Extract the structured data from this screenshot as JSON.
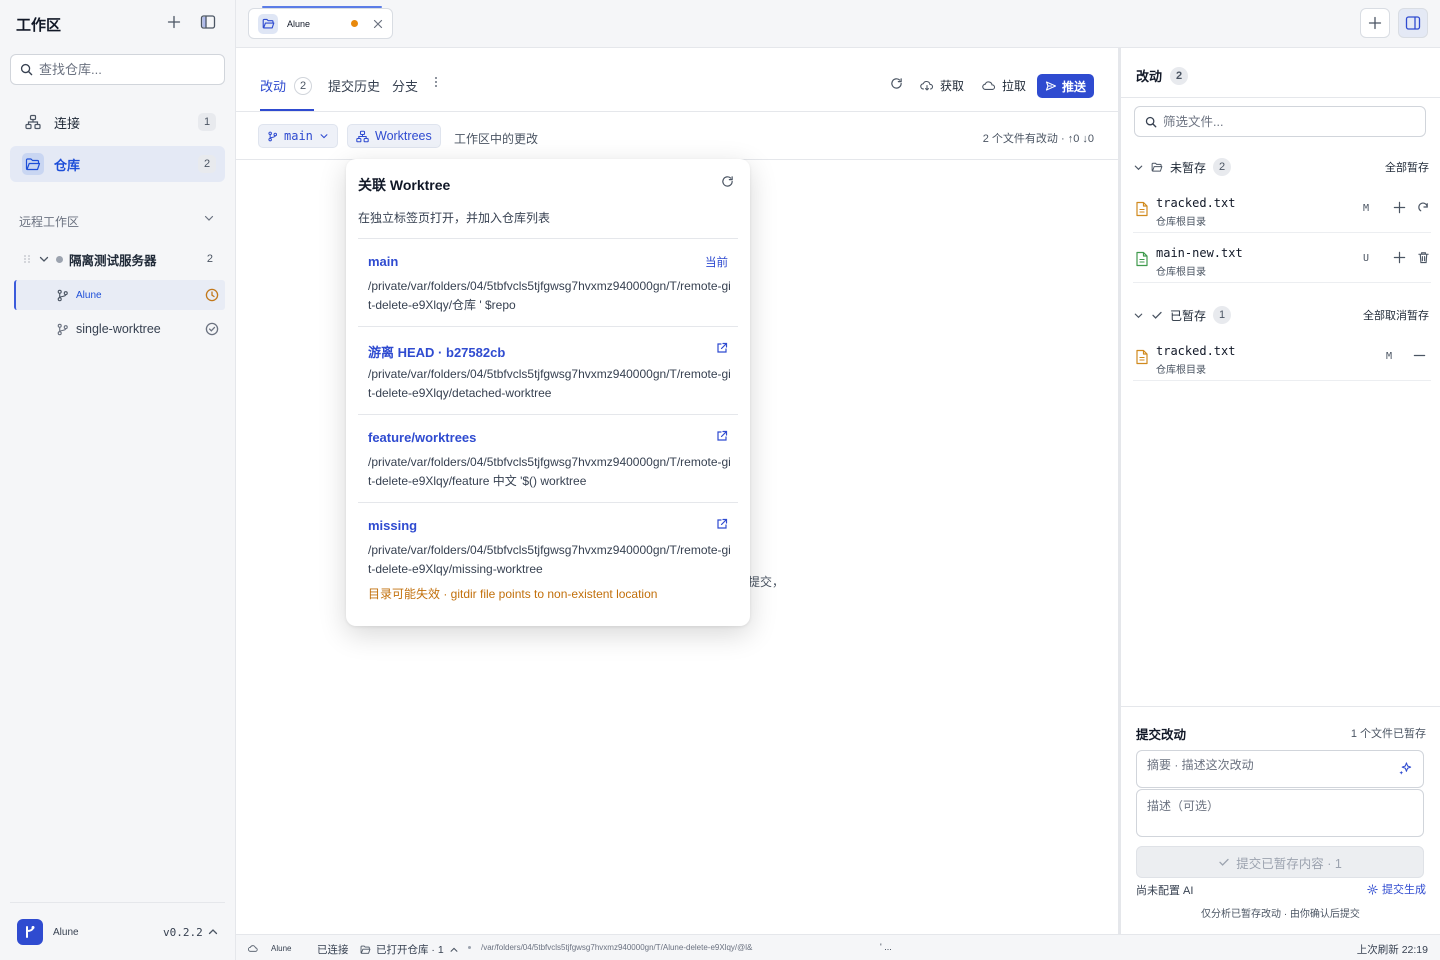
{
  "sidebar": {
    "title": "工作区",
    "search_placeholder": "查找仓库...",
    "nav": [
      {
        "label": "连接",
        "count": "1"
      },
      {
        "label": "仓库",
        "count": "2"
      }
    ],
    "remote_section": "远程工作区",
    "server": {
      "name": "隔离测试服务器",
      "count": "2"
    },
    "worktrees": [
      {
        "label": "Alune",
        "status": "clock-icon"
      },
      {
        "label": "single-worktree",
        "status": "check-circle-icon"
      }
    ],
    "footer": {
      "app_name": "Alune",
      "version": "v0.2.2"
    }
  },
  "tabbar": {
    "tab": {
      "label": "Alune"
    }
  },
  "main": {
    "tabs": [
      {
        "label": "改动",
        "count": "2"
      },
      {
        "label": "提交历史"
      },
      {
        "label": "分支"
      }
    ],
    "actions": {
      "fetch": "获取",
      "pull": "拉取",
      "push": "推送"
    },
    "branch": "main",
    "worktrees_chip": "Worktrees",
    "subtitle": "工作区中的更改",
    "summary": "2 个文件有改动 · ↑0 ↓0",
    "ghost_text": "提交，"
  },
  "popover": {
    "title": "关联 Worktree",
    "subtitle": "在独立标签页打开，并加入仓库列表",
    "items": [
      {
        "name": "main",
        "tag": "当前",
        "path": "/private/var/folders/04/5tbfvcls5tjfgwsg7hvxmz940000gn/T/remote-git-delete-e9Xlqy/仓库 ' $repo"
      },
      {
        "name": "游离 HEAD · b27582cb",
        "path": "/private/var/folders/04/5tbfvcls5tjfgwsg7hvxmz940000gn/T/remote-git-delete-e9Xlqy/detached-worktree"
      },
      {
        "name": "feature/worktrees",
        "path": "/private/var/folders/04/5tbfvcls5tjfgwsg7hvxmz940000gn/T/remote-git-delete-e9Xlqy/feature 中文 '$() worktree"
      },
      {
        "name": "missing",
        "path": "/private/var/folders/04/5tbfvcls5tjfgwsg7hvxmz940000gn/T/remote-git-delete-e9Xlqy/missing-worktree",
        "warning": "目录可能失效 · gitdir file points to non-existent location"
      }
    ]
  },
  "changes": {
    "title": "改动",
    "count": "2",
    "filter_placeholder": "筛选文件...",
    "unstaged": {
      "label": "未暂存",
      "count": "2",
      "action": "全部暂存",
      "files": [
        {
          "name": "tracked.txt",
          "dir": "仓库根目录",
          "code": "M"
        },
        {
          "name": "main-new.txt",
          "dir": "仓库根目录",
          "code": "U"
        }
      ]
    },
    "staged": {
      "label": "已暂存",
      "count": "1",
      "action": "全部取消暂存",
      "files": [
        {
          "name": "tracked.txt",
          "dir": "仓库根目录",
          "code": "M"
        }
      ]
    }
  },
  "commit": {
    "title": "提交改动",
    "staged_info": "1 个文件已暂存",
    "summary_placeholder": "摘要 · 描述这次改动",
    "desc_placeholder": "描述（可选）",
    "button": "提交已暂存内容 · 1",
    "ai_status": "尚未配置 AI",
    "generate": "提交生成",
    "note": "仅分析已暂存改动 · 由你确认后提交"
  },
  "statusbar": {
    "app": "Alune",
    "connection": "已连接",
    "repos": "已打开仓库 · 1",
    "path": "/var/folders/04/5tbfvcls5tjfgwsg7hvxmz940000gn/T/Alune-delete-e9Xlqy/@l&",
    "ellipsis": "' ...",
    "refresh": "上次刷新 22:19"
  }
}
